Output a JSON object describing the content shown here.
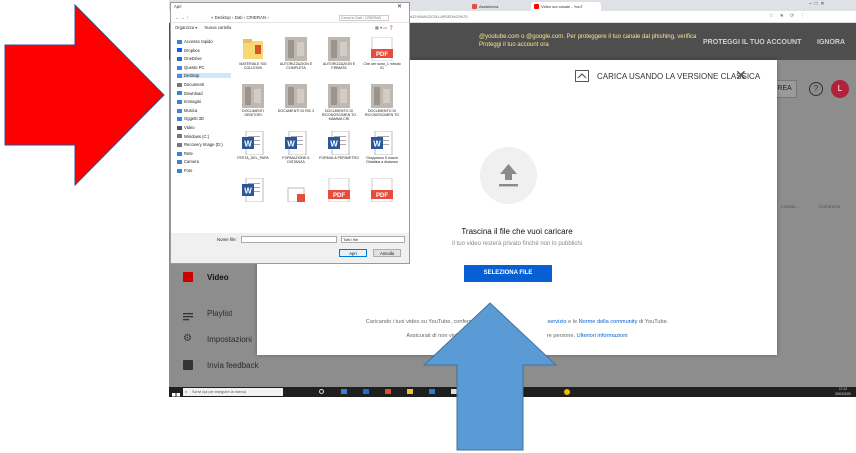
{
  "browser": {
    "tabs": [
      {
        "label": "Assistenza",
        "color": "#e84b3c"
      },
      {
        "label": "Video sul canale - YouT",
        "color": "#ff0000"
      }
    ],
    "url": "...id=bfeBd&r=%5B%5D&scrollTo=%7B%22isLocalScrollTop%22%3A0%2C%22offset%22%3A0%2C%22preload%22%3A%22COLLAPSED%22%7D"
  },
  "banner": {
    "text_line1": "@youtube.com o @google.com. Per proteggere il tuo canale dal phishing, verifica",
    "text_line2": "Proteggi il tuo account ora",
    "action1": "PROTEGGI IL TUO ACCOUNT",
    "action2": "IGNORA"
  },
  "yt_header": {
    "create_label": "CREA",
    "avatar_letter": "L"
  },
  "yt_sidebar": [
    {
      "label": "Video",
      "icon": "video-icon"
    },
    {
      "label": "Playlist",
      "icon": "playlist-icon"
    },
    {
      "label": "Impostazioni",
      "icon": "gear-icon"
    },
    {
      "label": "Invia feedback",
      "icon": "feedback-icon"
    }
  ],
  "yt_columns": {
    "col1": "Limitaz...",
    "col2": "Commenti"
  },
  "modal": {
    "title": "CARICA USANDO LA VERSIONE CLASSICA",
    "drag_title": "Trascina il file che vuoi caricare",
    "drag_sub": "Il tuo video resterà privato finché non lo pubblichi",
    "select_button": "SELEZIONA FILE",
    "terms_line1_a": "Caricando i tuoi video su YouTube, confermi di a",
    "terms_line1_link1": "servizio",
    "terms_line1_b": " e le ",
    "terms_line1_link2": "Norme della community",
    "terms_line1_c": " di YouTube.",
    "terms_line2_a": "Assicurati di non violare il copyr",
    "terms_line2_b": "re persone. ",
    "terms_line2_link": "Ulteriori informazioni"
  },
  "dialog": {
    "title": "Apri",
    "path": "« Desktop › Dati › CRIERAN ›",
    "search_placeholder": "Cerca in Dati › CRIERAN",
    "toolbar": {
      "organize": "Organizza ▾",
      "new_folder": "Nuova cartella"
    },
    "nav": [
      {
        "label": "Accesso rapido",
        "icon": "star-icon"
      },
      {
        "label": "Dropbox",
        "icon": "dropbox-icon"
      },
      {
        "label": "OneDrive",
        "icon": "cloud-icon"
      },
      {
        "label": "Questo PC",
        "icon": "pc-icon"
      },
      {
        "label": "Desktop",
        "icon": "folder-icon"
      },
      {
        "label": "Documenti",
        "icon": "document-icon"
      },
      {
        "label": "Download",
        "icon": "download-icon"
      },
      {
        "label": "Immagini",
        "icon": "image-icon"
      },
      {
        "label": "Musica",
        "icon": "music-icon"
      },
      {
        "label": "Oggetti 3D",
        "icon": "cube-icon"
      },
      {
        "label": "Video",
        "icon": "video-icon"
      },
      {
        "label": "Windows (C:)",
        "icon": "drive-icon"
      },
      {
        "label": "Recovery Image (D:)",
        "icon": "drive-icon"
      },
      {
        "label": "Rete",
        "icon": "network-icon"
      },
      {
        "label": "Camera",
        "icon": "camera-icon"
      },
      {
        "label": "Foto",
        "icon": "photo-icon"
      }
    ],
    "files": [
      {
        "name": "MATERIALE SIG COLLEGHI",
        "kind": "folder"
      },
      {
        "name": "AUTORIZZAZION E COMPLETA",
        "kind": "image"
      },
      {
        "name": "AUTORIZZAZION E FIRMATA",
        "kind": "image"
      },
      {
        "name": "Che ore sono_1 minuto 01",
        "kind": "pdf"
      },
      {
        "name": "DOCUMENTI GENITORI",
        "kind": "image"
      },
      {
        "name": "DOCUMENTI DI RIC 2",
        "kind": "image"
      },
      {
        "name": "DOCUMENTO DI RICONOSCIMEN TO MAMMA CRI",
        "kind": "image"
      },
      {
        "name": "DOCUMENTO DI RICONOSCIMEN TO",
        "kind": "image"
      },
      {
        "name": "FESTA_DEL_PAPA",
        "kind": "word"
      },
      {
        "name": "FORMAZIONE A DISTANZA",
        "kind": "word"
      },
      {
        "name": "FORMULA PERIMETRO",
        "kind": "word"
      },
      {
        "name": "Gruppiamo 5 marzo Didattica a distanza",
        "kind": "word"
      },
      {
        "name": "",
        "kind": "word"
      },
      {
        "name": "",
        "kind": "doc"
      },
      {
        "name": "",
        "kind": "pdf"
      },
      {
        "name": "",
        "kind": "pdf"
      }
    ],
    "filename_label": "Nome file:",
    "filetype": "Tutti i file",
    "open_button": "Apri",
    "cancel_button": "Annulla"
  },
  "taskbar": {
    "search_placeholder": "Scrivi qui per eseguire la ricerca",
    "time": "17:12",
    "date": "20/03/2020"
  },
  "annotations": {
    "arrow_color": "#ff0000",
    "up_arrow_color": "#5b9bd5"
  }
}
